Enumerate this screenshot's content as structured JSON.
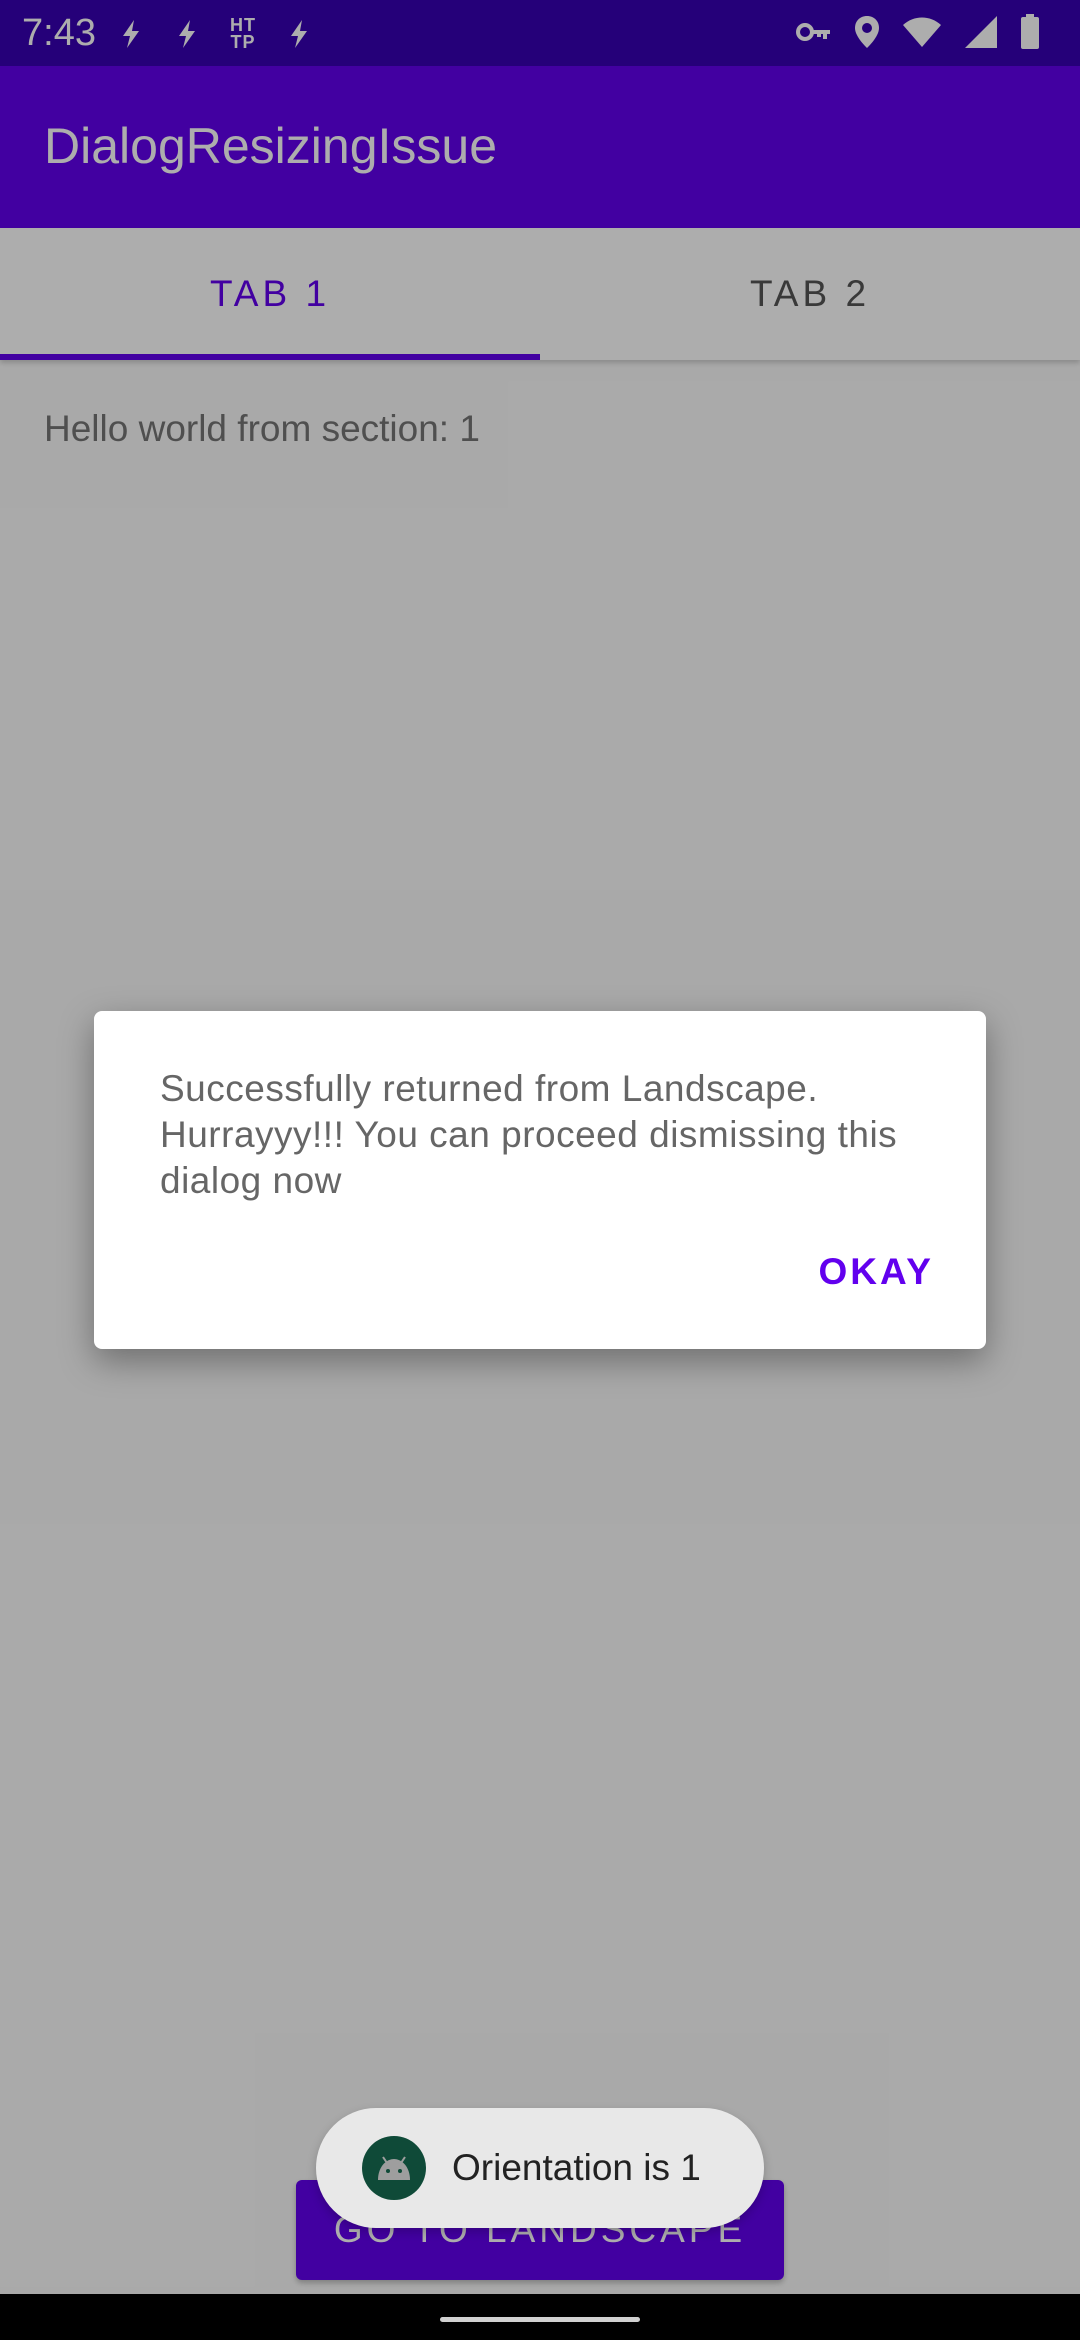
{
  "status_bar": {
    "time": "7:43",
    "left_icons": [
      "bolt-icon",
      "bolt-icon",
      "http-icon",
      "bolt-icon"
    ],
    "http_text_top": "HT",
    "http_text_bottom": "TP",
    "right_icons": [
      "vpn-key-icon",
      "location-icon",
      "wifi-icon",
      "cell-signal-icon",
      "battery-icon"
    ]
  },
  "app_bar": {
    "title": "DialogResizingIssue"
  },
  "tabs": [
    {
      "label": "TAB 1",
      "selected": true
    },
    {
      "label": "TAB 2",
      "selected": false
    }
  ],
  "content": {
    "section_label": "Hello world from section: 1",
    "landscape_button_label": "GO TO LANDSCAPE"
  },
  "dialog": {
    "message": "Successfully returned from Landscape. Hurrayyy!!! You can proceed dismissing this dialog now",
    "positive_button_label": "OKAY"
  },
  "toast": {
    "icon": "android-icon",
    "text": "Orientation is 1"
  },
  "colors": {
    "primary": "#6200ee",
    "primary_dark": "#3700b3",
    "surface": "#ffffff"
  }
}
